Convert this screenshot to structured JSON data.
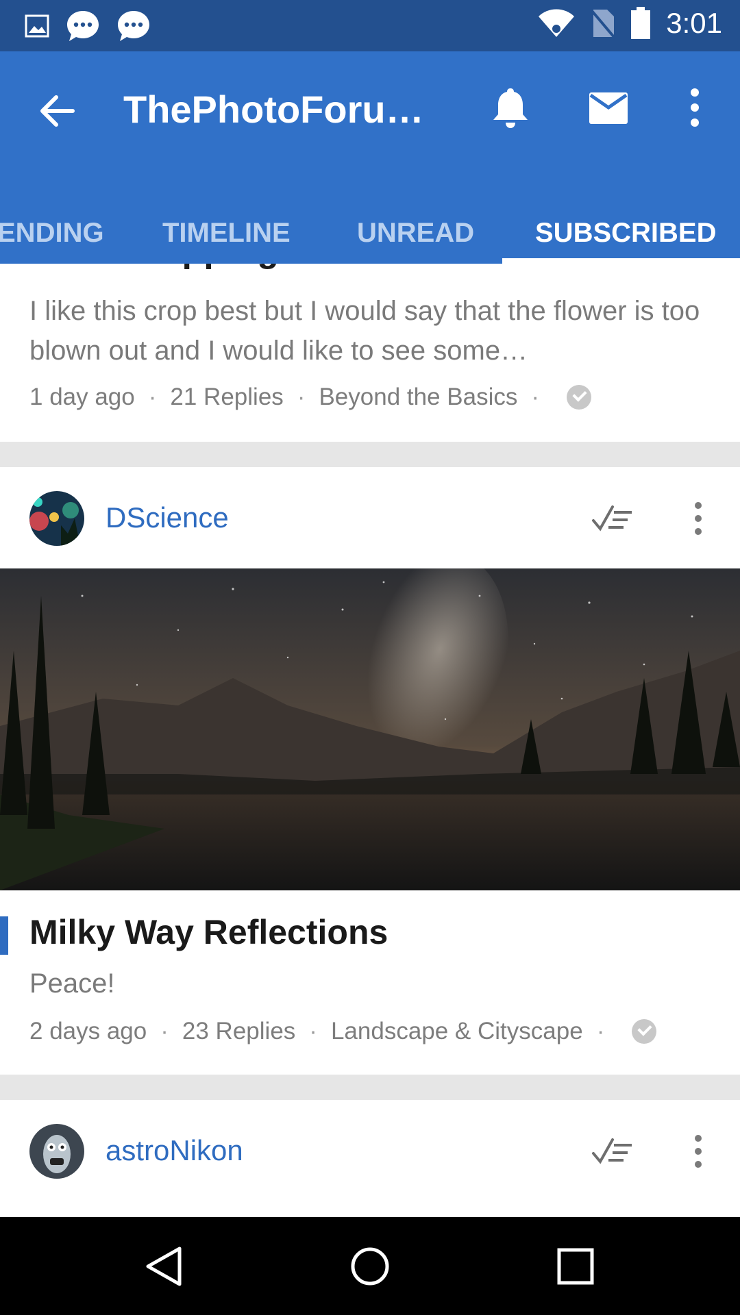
{
  "status_bar": {
    "time": "3:01",
    "left_icons": [
      "gallery-notification-icon",
      "chat-bubble-icon",
      "chat-bubble-icon"
    ],
    "right_icons": [
      "wifi-icon",
      "no-sim-icon",
      "battery-icon"
    ]
  },
  "app_bar": {
    "title": "ThePhotoForum…",
    "actions": [
      "back-arrow-icon",
      "bell-icon",
      "mail-icon",
      "more-vert-icon"
    ]
  },
  "tabs": [
    {
      "label": "ENDING",
      "active": false
    },
    {
      "label": "TIMELINE",
      "active": false
    },
    {
      "label": "UNREAD",
      "active": false
    },
    {
      "label": "SUBSCRIBED",
      "active": true
    }
  ],
  "feed": {
    "items": [
      {
        "title": "Head cropping",
        "excerpt": "I like this crop best but I would say that the flower is too blown out and I would like to see some…",
        "time": "1 day ago",
        "replies": "21 Replies",
        "forum": "Beyond the Basics"
      },
      {
        "author": "DScience",
        "title": "Milky Way Reflections",
        "excerpt": "Peace!",
        "time": "2 days ago",
        "replies": "23 Replies",
        "forum": "Landscape & Cityscape"
      },
      {
        "author": "astroNikon"
      }
    ]
  },
  "colors": {
    "status_bar": "#23508f",
    "app_bar": "#3171c8",
    "accent": "#2f6cc0",
    "background": "#e6e6e6"
  }
}
